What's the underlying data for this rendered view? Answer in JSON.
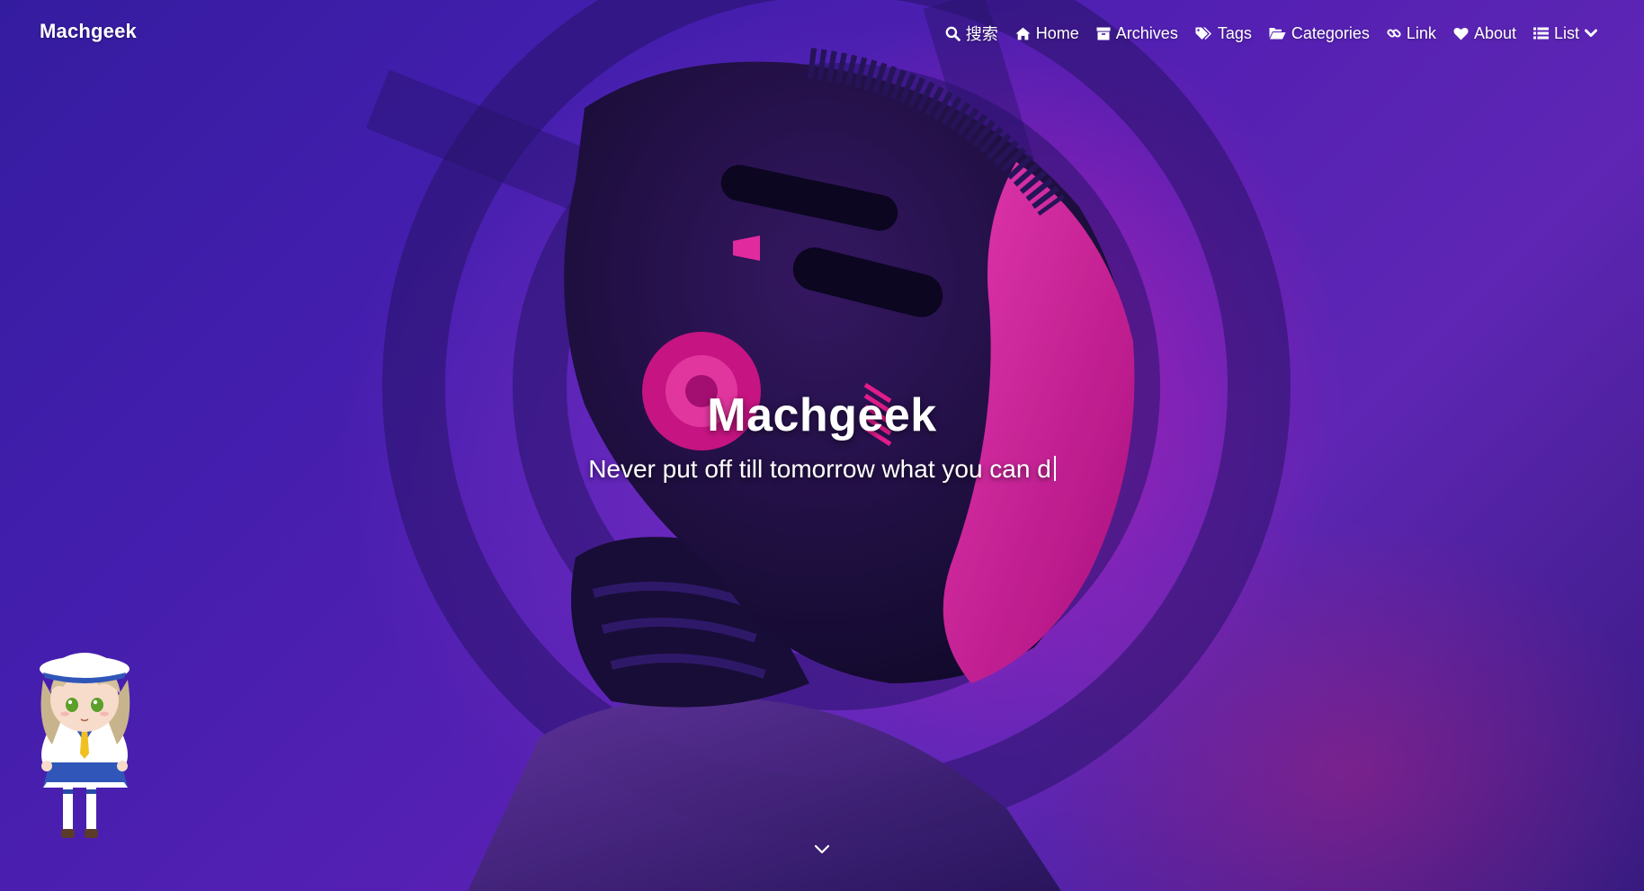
{
  "brand": {
    "name": "Machgeek"
  },
  "nav": {
    "items": [
      {
        "label": "搜索",
        "icon": "search-icon"
      },
      {
        "label": "Home",
        "icon": "home-icon"
      },
      {
        "label": "Archives",
        "icon": "archive-icon"
      },
      {
        "label": "Tags",
        "icon": "tags-icon"
      },
      {
        "label": "Categories",
        "icon": "folder-open-icon"
      },
      {
        "label": "Link",
        "icon": "link-icon"
      },
      {
        "label": "About",
        "icon": "heart-icon"
      },
      {
        "label": "List",
        "icon": "list-icon"
      }
    ]
  },
  "banner": {
    "title": "Machgeek",
    "subtitle": "Never put off till tomorrow what you can d"
  },
  "colors": {
    "background_primary": "#4a22c0",
    "accent_magenta": "#ff1fa8",
    "text": "#ffffff"
  },
  "icons": {
    "scroll": "chevron-down-icon",
    "mascot": "mascot-character"
  }
}
